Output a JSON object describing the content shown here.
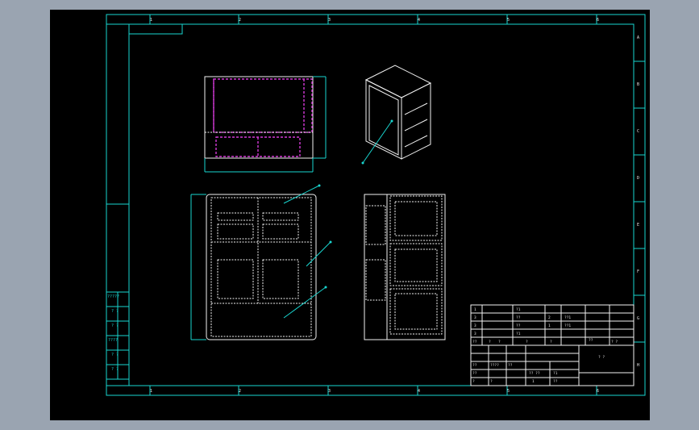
{
  "colors": {
    "background": "#9aa4b1",
    "canvas": "#000000",
    "frame_line": "#19d6d0",
    "geometry_line": "#f2f2f2",
    "hidden_line": "#d23ad6"
  },
  "frame": {
    "top_zone_numbers": [
      "1",
      "2",
      "3",
      "4",
      "5",
      "6"
    ],
    "bottom_zone_numbers": [
      "1",
      "2",
      "3",
      "4",
      "5",
      "6"
    ],
    "right_zone_letters": [
      "A",
      "B",
      "C",
      "D",
      "E",
      "F",
      "G",
      "H"
    ]
  },
  "left_strip": {
    "labels": [
      "?????",
      "? ?",
      "? ?",
      "????",
      "? ?",
      "? ?"
    ]
  },
  "title_block": {
    "rows": [
      [
        "1",
        "",
        "",
        "?1",
        "",
        "",
        ""
      ],
      [
        "3",
        "",
        "",
        "??",
        "2",
        "??1",
        ""
      ],
      [
        "3",
        "",
        "",
        "??",
        "1",
        "??1",
        ""
      ],
      [
        "3",
        "",
        "",
        "?1",
        "",
        "",
        ""
      ],
      [
        "??",
        "?",
        "?",
        "?",
        "?",
        "??",
        "? ?"
      ]
    ],
    "lower_labels": [
      "??",
      "??",
      "????",
      "??",
      "?",
      "?",
      "?? ??",
      "?1",
      "1",
      "??",
      "? ?"
    ]
  }
}
